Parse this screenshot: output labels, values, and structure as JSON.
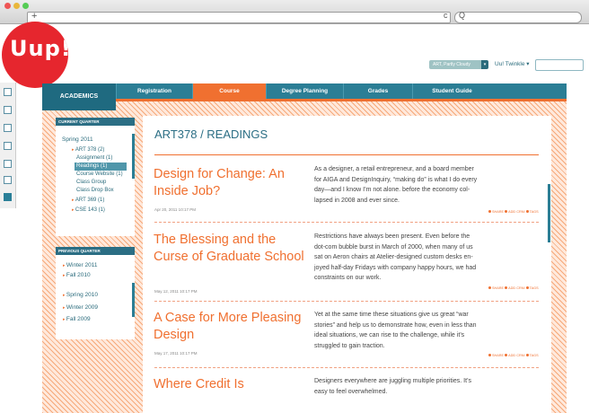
{
  "browser": {
    "new_tab": "+",
    "reload": "c",
    "search_icon": "Q"
  },
  "logo": {
    "text": "Uup!",
    "color": "#e6262e"
  },
  "topbar": {
    "weather": "ART, Partly Cloudy",
    "user": "Uu! Twinkle"
  },
  "nav": {
    "academics": "ACADEMICS",
    "tabs": [
      "Registration",
      "Course",
      "Degree Planning",
      "Grades",
      "Student Guide"
    ],
    "active": "Course",
    "accent": "#f07030",
    "primary": "#2b7e95"
  },
  "sidebar": {
    "current": {
      "heading": "CURRENT QUARTER",
      "term": "Spring 2011",
      "items": [
        "ART 378 (2)",
        "Assignment (1)",
        "Readings (1)",
        "Course Website (1)",
        "Class Group",
        "Class Drop Box",
        "ART 369 (1)",
        "CSE 143 (1)"
      ]
    },
    "previous": {
      "heading": "PREVIOUS QUARTER",
      "items": [
        "Winter 2011",
        "Fall 2010",
        "Spring 2010",
        "Winter 2009",
        "Fall 2009"
      ]
    }
  },
  "page": {
    "title": "ART378 / READINGS"
  },
  "articles": [
    {
      "title": "Design for Change: An Inside Job?",
      "date": "Apr 20, 2011 10:17 PM",
      "lines": [
        "As a designer, a retail entrepreneur, and a board member",
        "for AIGA and DesignInquiry, “making do” is what I do every",
        "day—and I know I’m not alone. before the economy col-",
        "lapsed in 2008 and ever since."
      ]
    },
    {
      "title": "The Blessing and the Curse of Graduate School",
      "date": "May 12, 2011 10:17 PM",
      "lines": [
        "Restrictions have always been present. Even before the",
        "dot-com bubble burst in March of 2000, when many of us",
        "sat on Aeron chairs at Atelier-designed custom desks en-",
        "joyed half-day Fridays with company happy hours, we had",
        "constraints on our work."
      ]
    },
    {
      "title": "A Case for More Pleasing Design",
      "date": "May 17, 2011 10:17 PM",
      "lines": [
        "Yet at the same time these situations give us great  “war",
        "stories” and help us to demonstrate how, even in less than",
        "ideal situations, we can rise to the challenge, while it’s",
        "struggled to gain traction."
      ]
    },
    {
      "title": "Where Credit Is",
      "date": "",
      "lines": [
        "Designers everywhere are juggling multiple priorities. It’s",
        "easy to feel overwhelmed."
      ]
    }
  ],
  "actions": {
    "share": "SHARE",
    "add": "ADD CRNI",
    "tags": "TAGS"
  }
}
